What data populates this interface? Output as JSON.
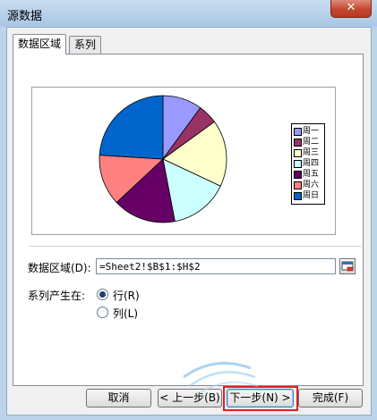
{
  "window": {
    "title": "源数据",
    "close_glyph": "✕"
  },
  "tabs": [
    {
      "label": "数据区域",
      "active": true
    },
    {
      "label": "系列",
      "active": false
    }
  ],
  "chart_data": {
    "type": "pie",
    "categories": [
      "周一",
      "周二",
      "周三",
      "周四",
      "周五",
      "周六",
      "周日"
    ],
    "values": [
      10,
      5,
      17,
      15,
      16,
      13,
      24
    ],
    "colors": [
      "#9999ff",
      "#993366",
      "#ffffcc",
      "#ccffff",
      "#660066",
      "#ff8080",
      "#0066cc"
    ],
    "legend_position": "right"
  },
  "data_range": {
    "label": "数据区域(D):",
    "value": "=Sheet2!$B$1:$H$2"
  },
  "series_in": {
    "label": "系列产生在:",
    "options": [
      {
        "label": "行(R)",
        "selected": true
      },
      {
        "label": "列(L)",
        "selected": false
      }
    ]
  },
  "buttons": {
    "cancel": "取消",
    "back": "< 上一步(B)",
    "next": "下一步(N) >",
    "finish": "完成(F)"
  }
}
